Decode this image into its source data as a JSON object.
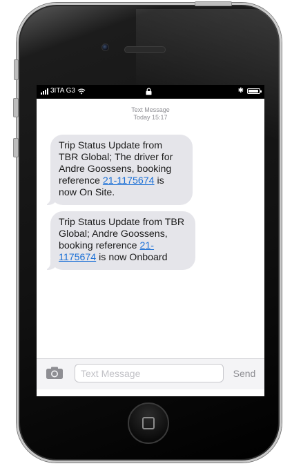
{
  "status_bar": {
    "carrier": "3ITA G3",
    "battery_level": 0.9,
    "icons": [
      "signal-icon",
      "wifi-icon",
      "lock-icon",
      "bluetooth-icon",
      "battery-icon"
    ]
  },
  "thread": {
    "title": "Text Message",
    "timestamp": "Today 15:17",
    "messages": [
      {
        "before": "Trip Status Update from TBR Global; The driver for Andre Goossens, booking reference ",
        "link": "21-1175674",
        "after": " is now On Site."
      },
      {
        "before": "Trip Status Update from TBR Global; Andre Goossens, booking reference ",
        "link": "21-1175674",
        "after": " is now Onboard"
      }
    ]
  },
  "input_bar": {
    "placeholder": "Text Message",
    "value": "",
    "send_label": "Send",
    "camera_icon": "camera-icon"
  },
  "colors": {
    "bubble": "#e5e5ea",
    "link": "#1a6fd6",
    "timestamp": "#8e8e93"
  }
}
